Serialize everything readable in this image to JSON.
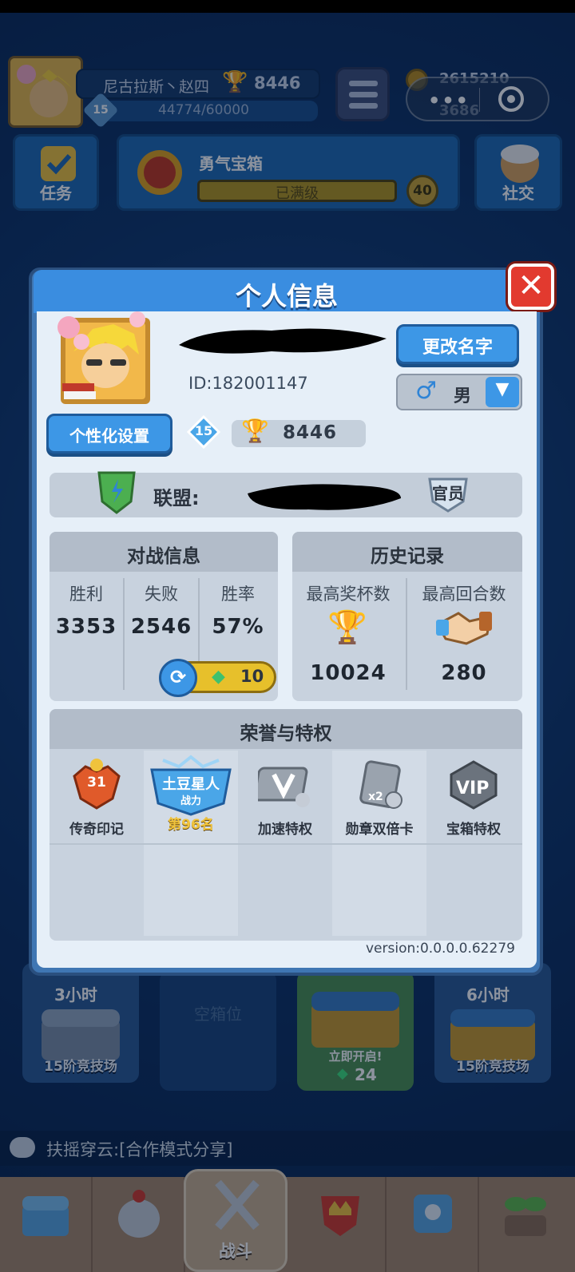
{
  "header": {
    "player_name": "尼古拉斯丶赵四",
    "trophies": "8446",
    "xp": "44774/60000",
    "level": "15",
    "gold": "2615210",
    "gems": "3686"
  },
  "top_buttons": {
    "tasks": "任务",
    "chest_title": "勇气宝箱",
    "chest_status": "已满级",
    "chest_level": "40",
    "social": "社交"
  },
  "dialog": {
    "title": "个人信息",
    "rename": "更改名字",
    "player_id": "ID:182001147",
    "gender_symbol": "♂",
    "gender": "男",
    "customize": "个性化设置",
    "level": "15",
    "trophies": "8446",
    "alliance_label": "联盟:",
    "alliance_rank": "官员",
    "battle": {
      "title": "对战信息",
      "wins_label": "胜利",
      "losses_label": "失败",
      "rate_label": "胜率",
      "wins": "3353",
      "losses": "2546",
      "rate": "57%",
      "refresh_cost": "10"
    },
    "history": {
      "title": "历史记录",
      "max_trophies_label": "最高奖杯数",
      "max_rounds_label": "最高回合数",
      "max_trophies": "10024",
      "max_rounds": "280"
    },
    "honor": {
      "title": "荣誉与特权",
      "items": [
        {
          "label": "传奇印记",
          "badge": "31"
        },
        {
          "label": "土豆星人",
          "sub": "战力",
          "rank": "第96名"
        },
        {
          "label": "加速特权"
        },
        {
          "label": "勋章双倍卡"
        },
        {
          "label": "宝箱特权"
        }
      ]
    },
    "version": "version:0.0.0.0.62279"
  },
  "chests": {
    "slot1_timer": "3小时",
    "slot1_label": "15阶竞技场",
    "slot2_label": "空箱位",
    "slot3_action": "立即开启!",
    "slot3_cost": "24",
    "slot4_timer": "6小时",
    "slot4_label": "15阶竞技场"
  },
  "chat": {
    "message": "扶摇穿云:[合作模式分享]"
  },
  "nav": {
    "fight": "战斗"
  }
}
